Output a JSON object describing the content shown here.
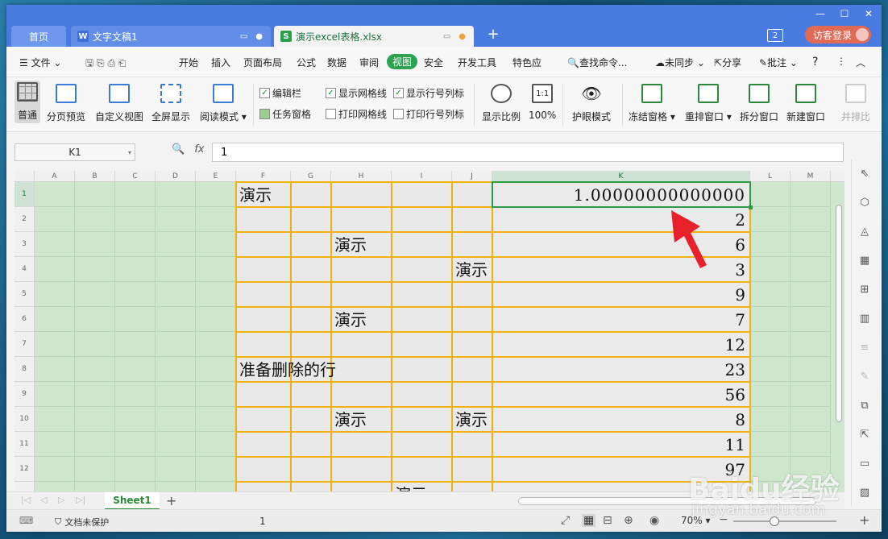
{
  "tabs": {
    "home": "首页",
    "doc": "文字文稿1",
    "xlsx": "演示excel表格.xlsx",
    "new_tab": "+"
  },
  "titlebar": {
    "window_count": "2",
    "visitor_login": "访客登录"
  },
  "menu": {
    "file": "文件",
    "items": [
      "开始",
      "插入",
      "页面布局",
      "公式",
      "数据",
      "审阅",
      "视图",
      "安全",
      "开发工具",
      "特色应"
    ],
    "search": "查找命令...",
    "sync": "未同步",
    "share": "分享",
    "annotate": "批注",
    "help": "?"
  },
  "ribbon": {
    "normal": "普通",
    "page_preview": "分页预览",
    "custom_view": "自定义视图",
    "fullscreen": "全屏显示",
    "reading_mode": "阅读模式",
    "edit_bar": "编辑栏",
    "task_pane": "任务窗格",
    "show_gridlines": "显示网格线",
    "print_gridlines": "打印网格线",
    "show_row_col": "显示行号列标",
    "print_row_col": "打印行号列标",
    "zoom_ratio": "显示比例",
    "zoom_100": "100%",
    "zoom_100_icon": "1:1",
    "eye_mode": "护眼模式",
    "freeze": "冻结窗格",
    "arrange": "重排窗口",
    "split": "拆分窗口",
    "new_window": "新建窗口",
    "side_by_side": "并排比"
  },
  "formula_bar": {
    "name_box": "K1",
    "fx": "fx",
    "value": "1"
  },
  "grid": {
    "columns": [
      "A",
      "B",
      "C",
      "D",
      "E",
      "F",
      "G",
      "H",
      "I",
      "J",
      "K",
      "L",
      "M"
    ],
    "rows": [
      "1",
      "2",
      "3",
      "4",
      "5",
      "6",
      "7",
      "8",
      "9",
      "10",
      "11",
      "12"
    ],
    "cell_text": {
      "F1": "演示",
      "H3": "演示",
      "J4": "演示",
      "H6": "演示",
      "F8": "准备删除的行",
      "H10": "演示",
      "J10": "演示",
      "I13": "演示"
    },
    "k_values": [
      "1.00000000000000",
      "2",
      "6",
      "3",
      "9",
      "7",
      "12",
      "23",
      "56",
      "8",
      "11",
      "97"
    ]
  },
  "sheet_tabs": {
    "active": "Sheet1",
    "add": "+"
  },
  "status": {
    "protection": "文档未保护",
    "value": "1",
    "zoom": "70%"
  },
  "watermark": {
    "main": "Baidu经验",
    "sub": "jingyan.baidu.com"
  },
  "colors": {
    "title_bar": "#4a7be0",
    "accent_green": "#2ba34f",
    "cell_border_orange": "#f1b211",
    "eye_mode_bg": "#cde6cc",
    "arrow_red": "#e8202a"
  }
}
